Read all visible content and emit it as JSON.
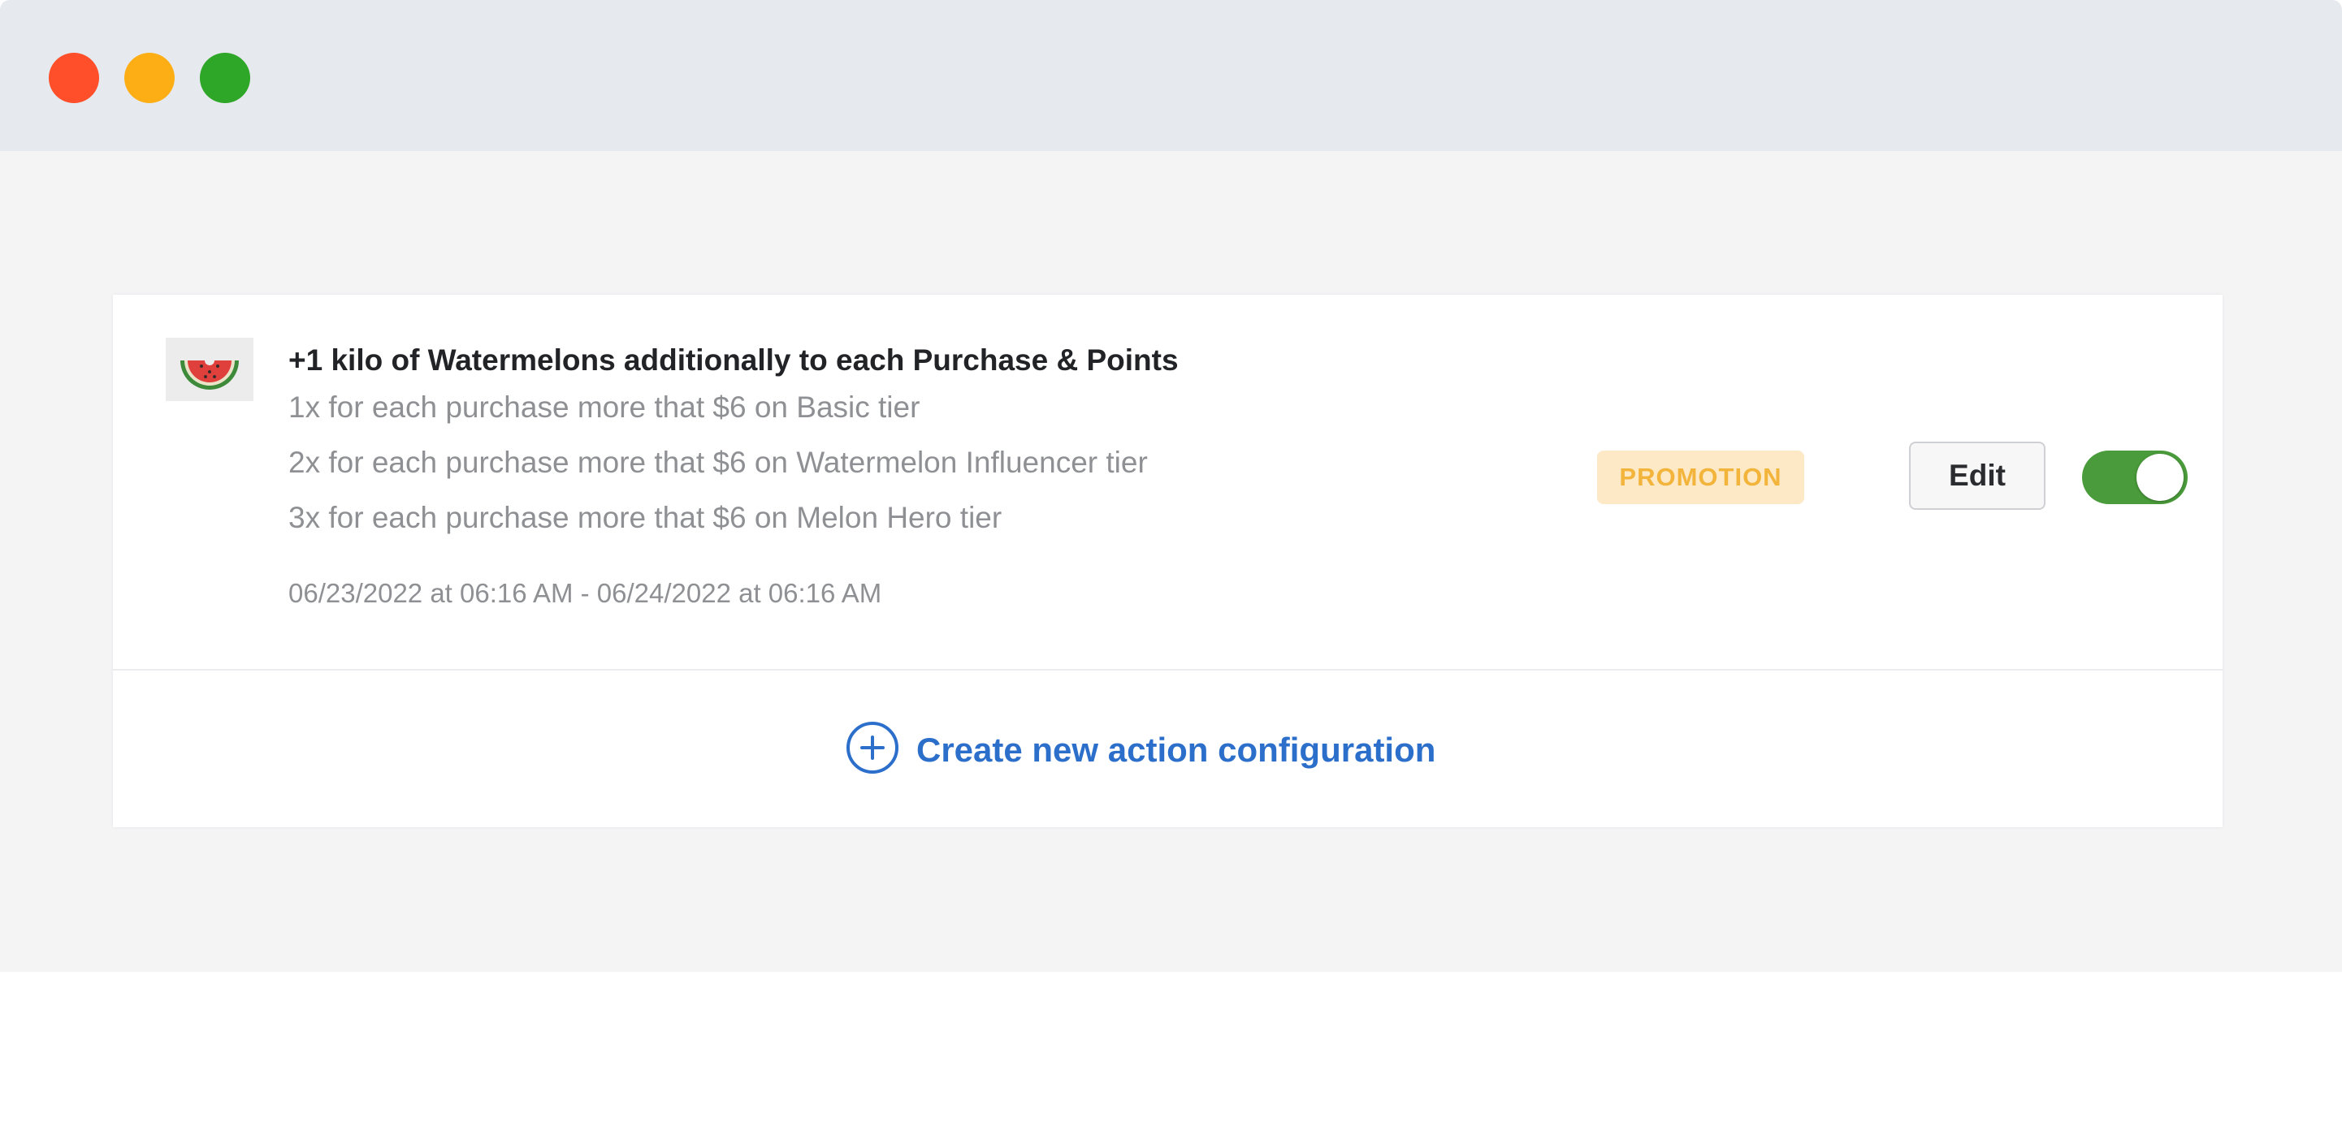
{
  "window": {
    "controls": {
      "close_color": "#fe4f2a",
      "minimize_color": "#fdae14",
      "maximize_color": "#2ea627"
    }
  },
  "action": {
    "icon": "watermelon-slice-icon",
    "title": "+1 kilo of Watermelons additionally to each Purchase & Points",
    "rules": [
      "1x for each purchase more that $6 on Basic tier",
      "2x for each purchase more that $6 on Watermelon Influencer tier",
      "3x for each purchase more that $6 on Melon Hero tier"
    ],
    "date_range": "06/23/2022 at 06:16 AM - 06/24/2022 at 06:16 AM",
    "badge": "PROMOTION",
    "edit_label": "Edit",
    "enabled": true
  },
  "create": {
    "icon": "plus-circle-icon",
    "label": "Create new action configuration"
  },
  "colors": {
    "accent": "#2c6fcb",
    "toggle_on": "#4a9b3b",
    "badge_bg": "#fde9c6",
    "badge_text": "#f3b43b"
  }
}
